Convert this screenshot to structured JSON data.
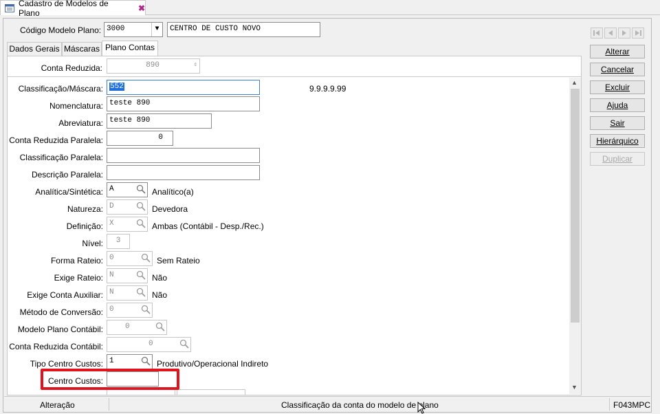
{
  "app": {
    "tab_title": "Cadastro de Modelos de Plano",
    "brand_color": "#1e6fd9",
    "highlight_color": "#e0141e"
  },
  "header": {
    "codigo_label": "Código Modelo Plano:",
    "codigo_value": "3000",
    "descricao_value": "CENTRO DE CUSTO NOVO"
  },
  "tabs": [
    {
      "label": "Dados Gerais"
    },
    {
      "label": "Máscaras"
    },
    {
      "label": "Plano Contas"
    }
  ],
  "conta_reduzida": {
    "label": "Conta Reduzida:",
    "value": "890"
  },
  "form": {
    "classificacao": {
      "label": "Classificação/Máscara:",
      "value": "552",
      "mask": "9.9.9.9.99"
    },
    "nomenclatura": {
      "label": "Nomenclatura:",
      "value": "teste 890"
    },
    "abreviatura": {
      "label": "Abreviatura:",
      "value": "teste 890"
    },
    "conta_paralela": {
      "label": "Conta Reduzida Paralela:",
      "value": "0"
    },
    "classificacao_paralela": {
      "label": "Classificação Paralela:",
      "value": ""
    },
    "descricao_paralela": {
      "label": "Descrição Paralela:",
      "value": ""
    },
    "analitica": {
      "label": "Analítica/Sintética:",
      "value": "A",
      "desc": "Analítico(a)"
    },
    "natureza": {
      "label": "Natureza:",
      "value": "D",
      "desc": "Devedora"
    },
    "definicao": {
      "label": "Definição:",
      "value": "X",
      "desc": "Ambas (Contábil - Desp./Rec.)"
    },
    "nivel": {
      "label": "Nível:",
      "value": "3"
    },
    "forma_rateio": {
      "label": "Forma Rateio:",
      "value": "0",
      "desc": "Sem Rateio"
    },
    "exige_rateio": {
      "label": "Exige Rateio:",
      "value": "N",
      "desc": "Não"
    },
    "exige_conta_aux": {
      "label": "Exige Conta Auxiliar:",
      "value": "N",
      "desc": "Não"
    },
    "metodo_conversao": {
      "label": "Método de Conversão:",
      "value": "0"
    },
    "modelo_plano_contabil": {
      "label": "Modelo Plano Contábil:",
      "value": "0"
    },
    "conta_reduzida_contabil": {
      "label": "Conta Reduzida Contábil:",
      "value": "0"
    },
    "tipo_centro_custos": {
      "label": "Tipo Centro Custos:",
      "value": "1",
      "desc": "Produtivo/Operacional Indireto"
    },
    "centro_custos": {
      "label": "Centro Custos:",
      "value": ""
    }
  },
  "buttons": [
    {
      "label": "Alterar"
    },
    {
      "label": "Cancelar"
    },
    {
      "label": "Excluir"
    },
    {
      "label": "Ajuda"
    },
    {
      "label": "Sair"
    },
    {
      "label": "Hierárquico"
    },
    {
      "label": "Duplicar"
    }
  ],
  "status": {
    "mode": "Alteração",
    "hint": "Classificação da conta do modelo de plano",
    "screen_code": "F043MPC"
  }
}
